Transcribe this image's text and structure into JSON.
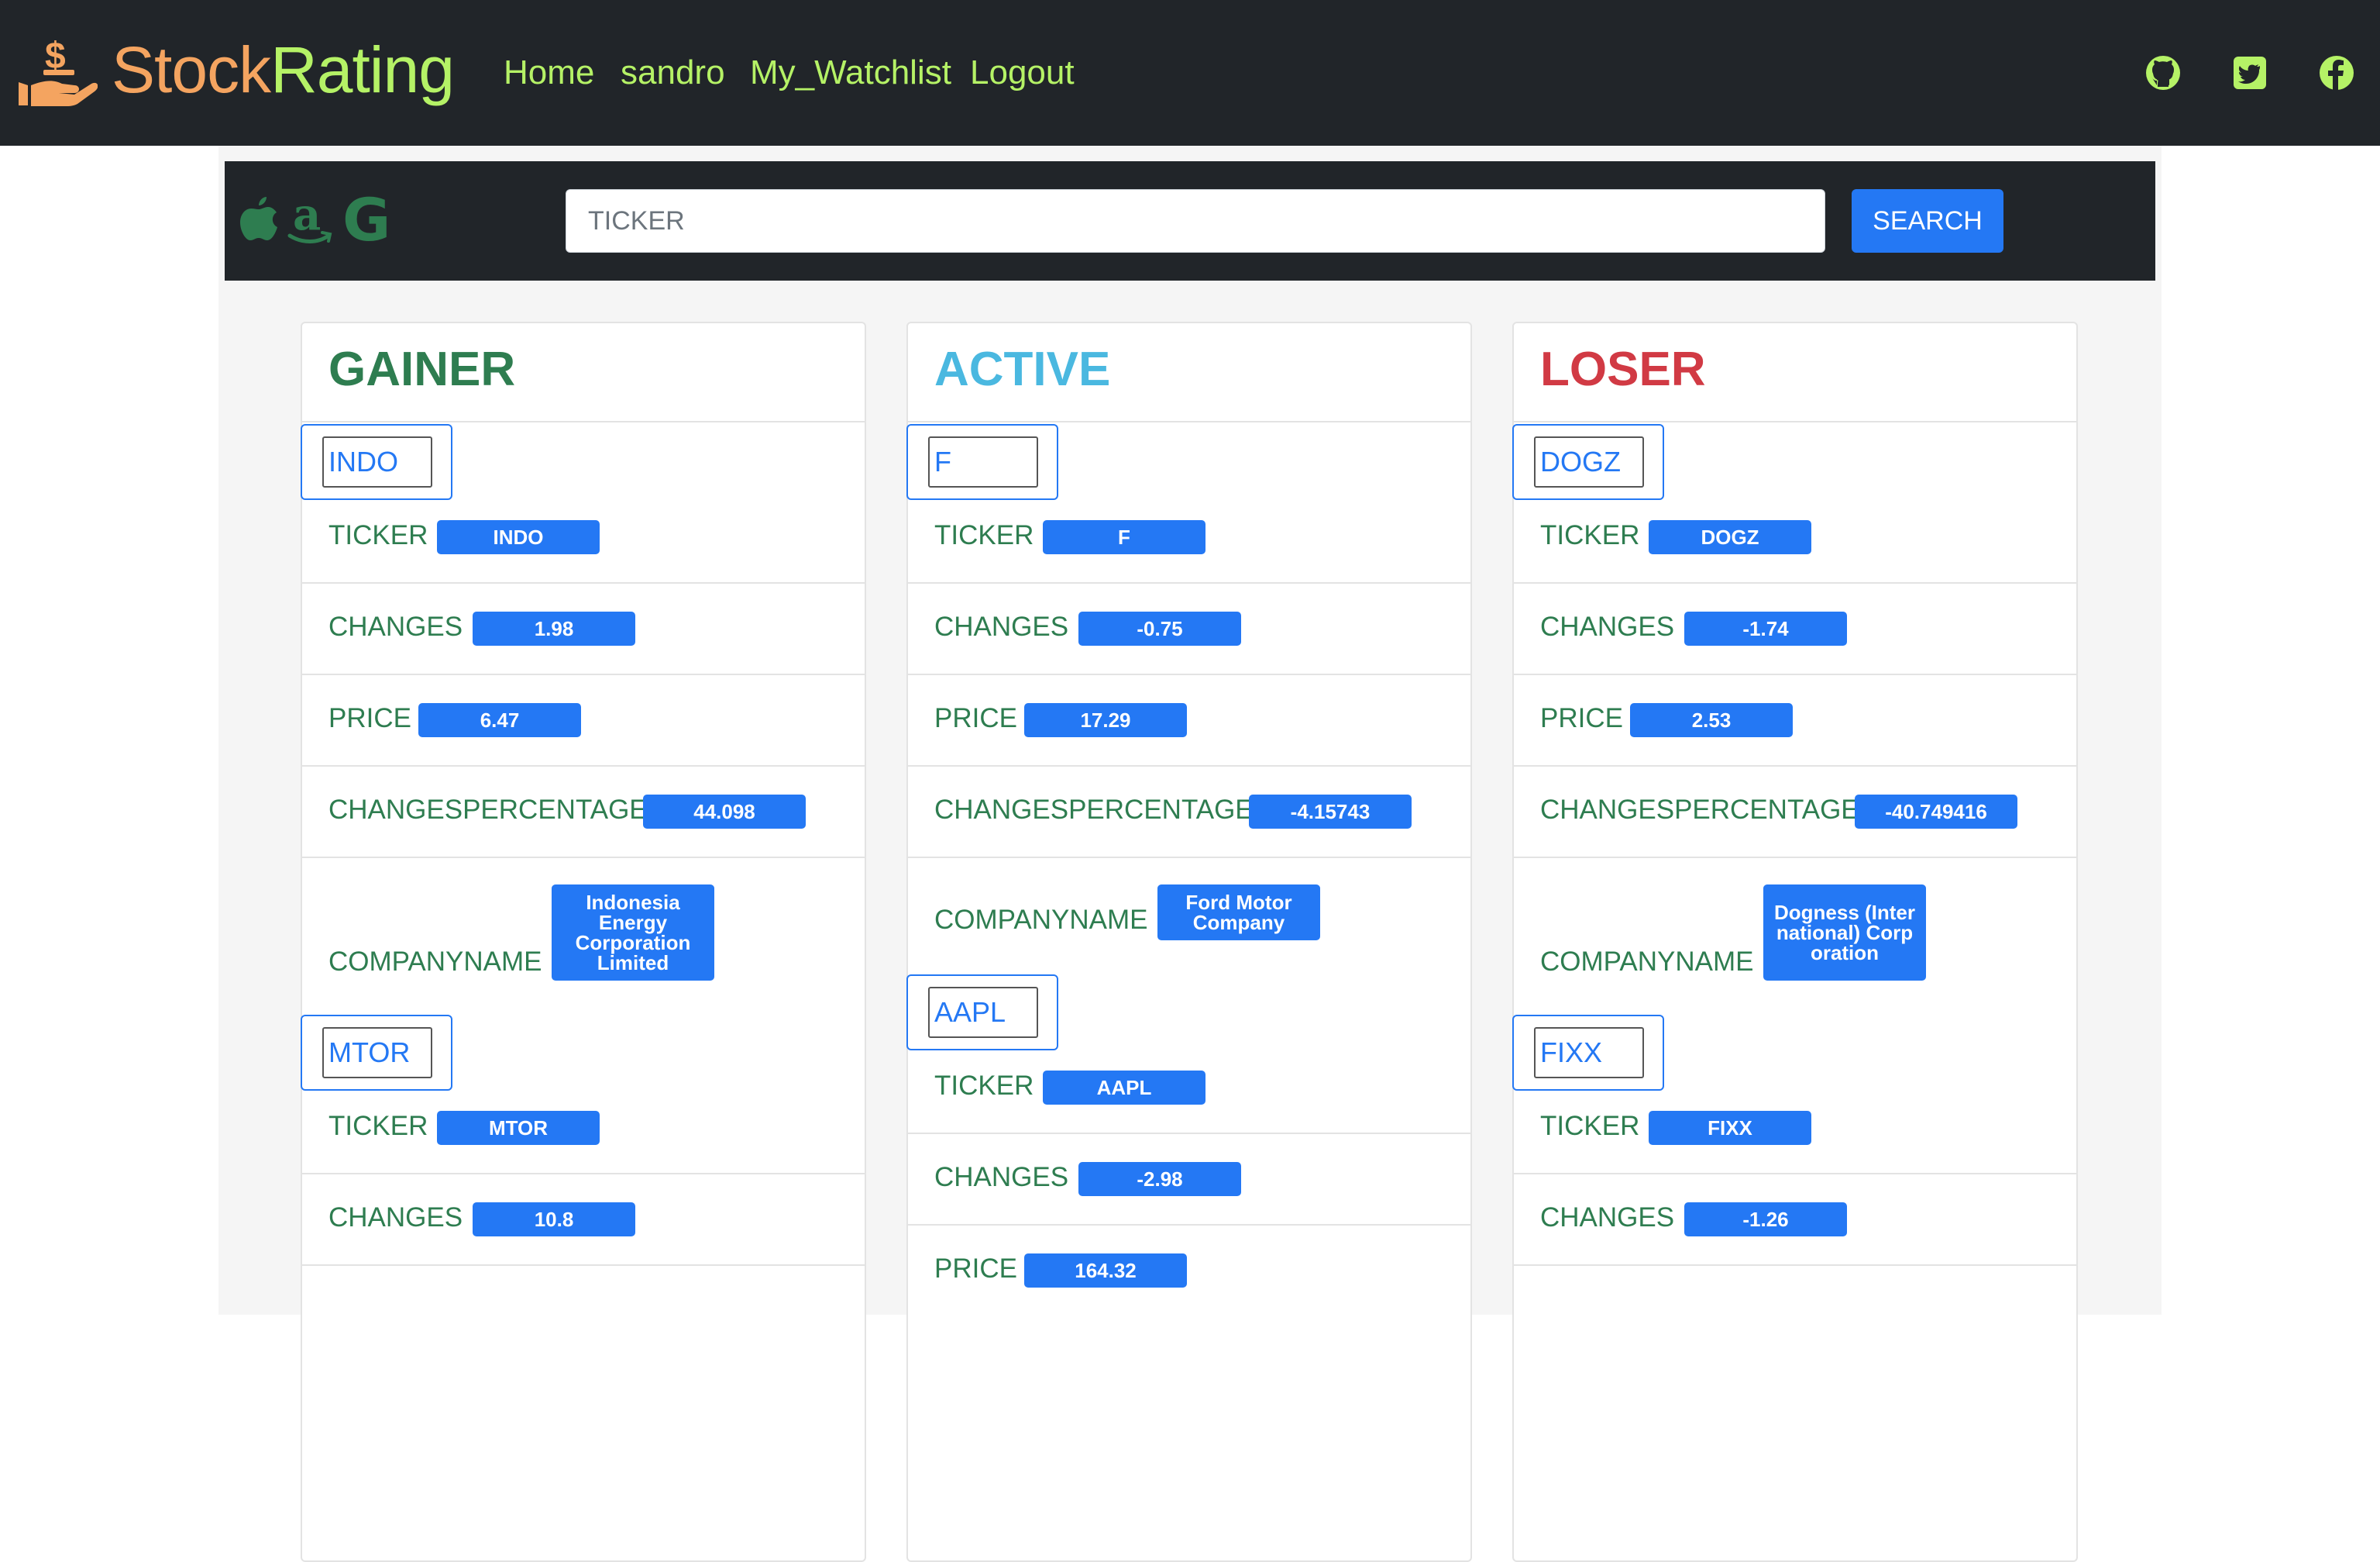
{
  "brand": {
    "part1": "Stock",
    "part2": "Rating"
  },
  "nav": {
    "home": "Home",
    "user": "sandro",
    "watchlist": "My_Watchlist",
    "logout": "Logout"
  },
  "search": {
    "placeholder": "TICKER",
    "button": "SEARCH"
  },
  "labels": {
    "ticker": "TICKER",
    "changes": "CHANGES",
    "price": "PRICE",
    "changes_percentage": "CHANGESPERCENTAGE",
    "company_name": "COMPANYNAME"
  },
  "gainer": {
    "title": "GAINER",
    "stocks": [
      {
        "symbol": "INDO",
        "ticker": "INDO",
        "changes": "1.98",
        "price": "6.47",
        "changes_percentage": "44.098",
        "company_name": "Indonesia Energy Corporation Limited"
      },
      {
        "symbol": "MTOR",
        "ticker": "MTOR",
        "changes": "10.8"
      }
    ]
  },
  "active": {
    "title": "ACTIVE",
    "stocks": [
      {
        "symbol": "F",
        "ticker": "F",
        "changes": "-0.75",
        "price": "17.29",
        "changes_percentage": "-4.15743",
        "company_name": "Ford Motor Company"
      },
      {
        "symbol": "AAPL",
        "ticker": "AAPL",
        "changes": "-2.98",
        "price": "164.32"
      }
    ]
  },
  "loser": {
    "title": "LOSER",
    "stocks": [
      {
        "symbol": "DOGZ",
        "ticker": "DOGZ",
        "changes": "-1.74",
        "price": "2.53",
        "changes_percentage": "-40.749416",
        "company_name": "Dogness (International) Corporation"
      },
      {
        "symbol": "FIXX",
        "ticker": "FIXX",
        "changes": "-1.26"
      }
    ]
  },
  "colors": {
    "navbar": "#212529",
    "nav_link": "#b5f266",
    "brand_accent": "#f4a460",
    "badge": "#2478f4",
    "label": "#2e7d50",
    "gainer": "#2e7d50",
    "active": "#4ab8e0",
    "loser": "#d13a44"
  },
  "icons": {
    "brand": "money-hand-icon",
    "social": [
      "github-icon",
      "twitter-icon",
      "facebook-icon"
    ],
    "mini_logos": [
      "apple-icon",
      "amazon-icon",
      "google-icon"
    ]
  }
}
